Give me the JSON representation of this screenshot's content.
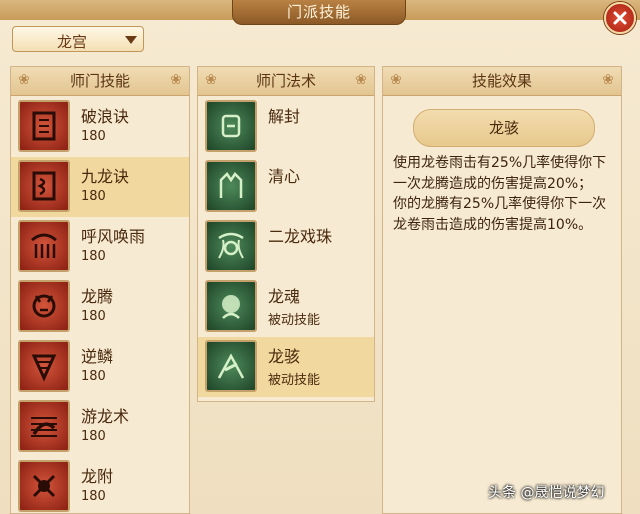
{
  "window": {
    "title": "门派技能"
  },
  "sect_dropdown": {
    "value": "龙宫"
  },
  "panels": {
    "sect_skills": {
      "title": "师门技能",
      "items": [
        {
          "name": "破浪诀",
          "level": "180",
          "icon": "wave-glyph-icon"
        },
        {
          "name": "九龙诀",
          "level": "180",
          "icon": "dragon-scroll-icon"
        },
        {
          "name": "呼风唤雨",
          "level": "180",
          "icon": "wind-rain-icon"
        },
        {
          "name": "龙腾",
          "level": "180",
          "icon": "dragon-rise-icon"
        },
        {
          "name": "逆鳞",
          "level": "180",
          "icon": "reverse-scale-icon"
        },
        {
          "name": "游龙术",
          "level": "180",
          "icon": "roaming-dragon-icon"
        },
        {
          "name": "龙附",
          "level": "180",
          "icon": "dragon-attach-icon"
        }
      ]
    },
    "sect_spells": {
      "title": "师门法术",
      "items": [
        {
          "name": "解封",
          "sub": "",
          "icon": "unseal-icon"
        },
        {
          "name": "清心",
          "sub": "",
          "icon": "clear-mind-icon"
        },
        {
          "name": "二龙戏珠",
          "sub": "",
          "icon": "twin-dragon-pearl-icon"
        },
        {
          "name": "龙魂",
          "sub": "被动技能",
          "icon": "dragon-soul-icon"
        },
        {
          "name": "龙骇",
          "sub": "被动技能",
          "icon": "dragon-fear-icon"
        }
      ]
    },
    "skill_effect": {
      "title": "技能效果",
      "selected_name": "龙骇",
      "description": "使用龙卷雨击有25%几率使得你下一次龙腾造成的伤害提高20%；\n你的龙腾有25%几率使得你下一次龙卷雨击造成的伤害提高10%。"
    }
  },
  "watermark": "头条 @晟恺说梦幻",
  "colors": {
    "accent": "#c89b5a",
    "selected_row": "#f0d89e",
    "close": "#c23a22"
  }
}
